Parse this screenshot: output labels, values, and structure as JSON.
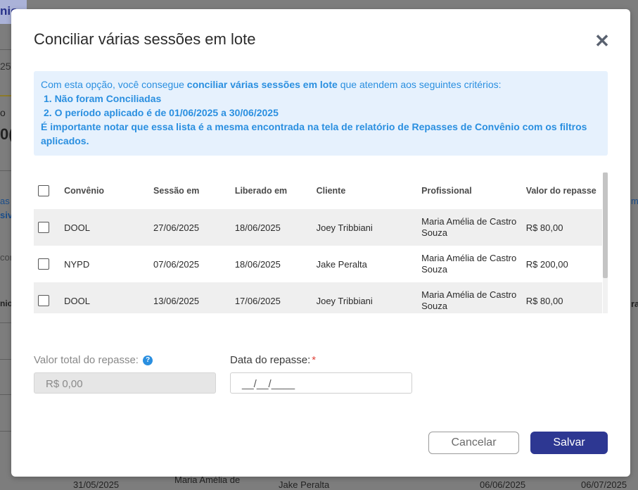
{
  "background": {
    "tab_label": "nio",
    "left_texts": [
      "25",
      "o",
      "0(",
      "as",
      "sive",
      "con",
      "nio"
    ],
    "right_texts": [
      "me",
      "ra"
    ],
    "bottom_row": [
      "31/05/2025",
      "Maria Amélia de",
      "Jake Peralta",
      "06/06/2025",
      "06/07/2025"
    ]
  },
  "modal": {
    "title": "Conciliar várias sessões em lote",
    "close_icon": "close-icon",
    "info": {
      "intro_before": "Com esta opção, você consegue ",
      "intro_bold": "conciliar várias sessões em lote",
      "intro_after": " que atendem aos seguintes critérios:",
      "criteria": [
        "1. Não foram Conciliadas",
        "2. O período aplicado é de 01/06/2025 a 30/06/2025"
      ],
      "note": "É importante notar que essa lista é a mesma encontrada na tela de relatório de Repasses de Convênio com os filtros aplicados."
    },
    "table": {
      "headers": {
        "convenio": "Convênio",
        "sessao": "Sessão em",
        "liberado": "Liberado em",
        "cliente": "Cliente",
        "profissional": "Profissional",
        "valor": "Valor do repasse"
      },
      "rows": [
        {
          "convenio": "DOOL",
          "sessao": "27/06/2025",
          "liberado": "18/06/2025",
          "cliente": "Joey Tribbiani",
          "profissional": "Maria Amélia de Castro Souza",
          "valor": "R$ 80,00"
        },
        {
          "convenio": "NYPD",
          "sessao": "07/06/2025",
          "liberado": "18/06/2025",
          "cliente": "Jake Peralta",
          "profissional": "Maria Amélia de Castro Souza",
          "valor": "R$ 200,00"
        },
        {
          "convenio": "DOOL",
          "sessao": "13/06/2025",
          "liberado": "17/06/2025",
          "cliente": "Joey Tribbiani",
          "profissional": "Maria Amélia de Castro Souza",
          "valor": "R$ 80,00"
        }
      ]
    },
    "form": {
      "valor_label": "Valor total do repasse:",
      "valor_value": "R$ 0,00",
      "data_label": "Data do repasse:",
      "data_required": "*",
      "data_placeholder": "__/__/____"
    },
    "buttons": {
      "cancel": "Cancelar",
      "save": "Salvar"
    },
    "colors": {
      "primary": "#2d3792",
      "info_text": "#2a8fe0",
      "info_bg": "#e6f1fd",
      "required": "#e0453c"
    }
  }
}
